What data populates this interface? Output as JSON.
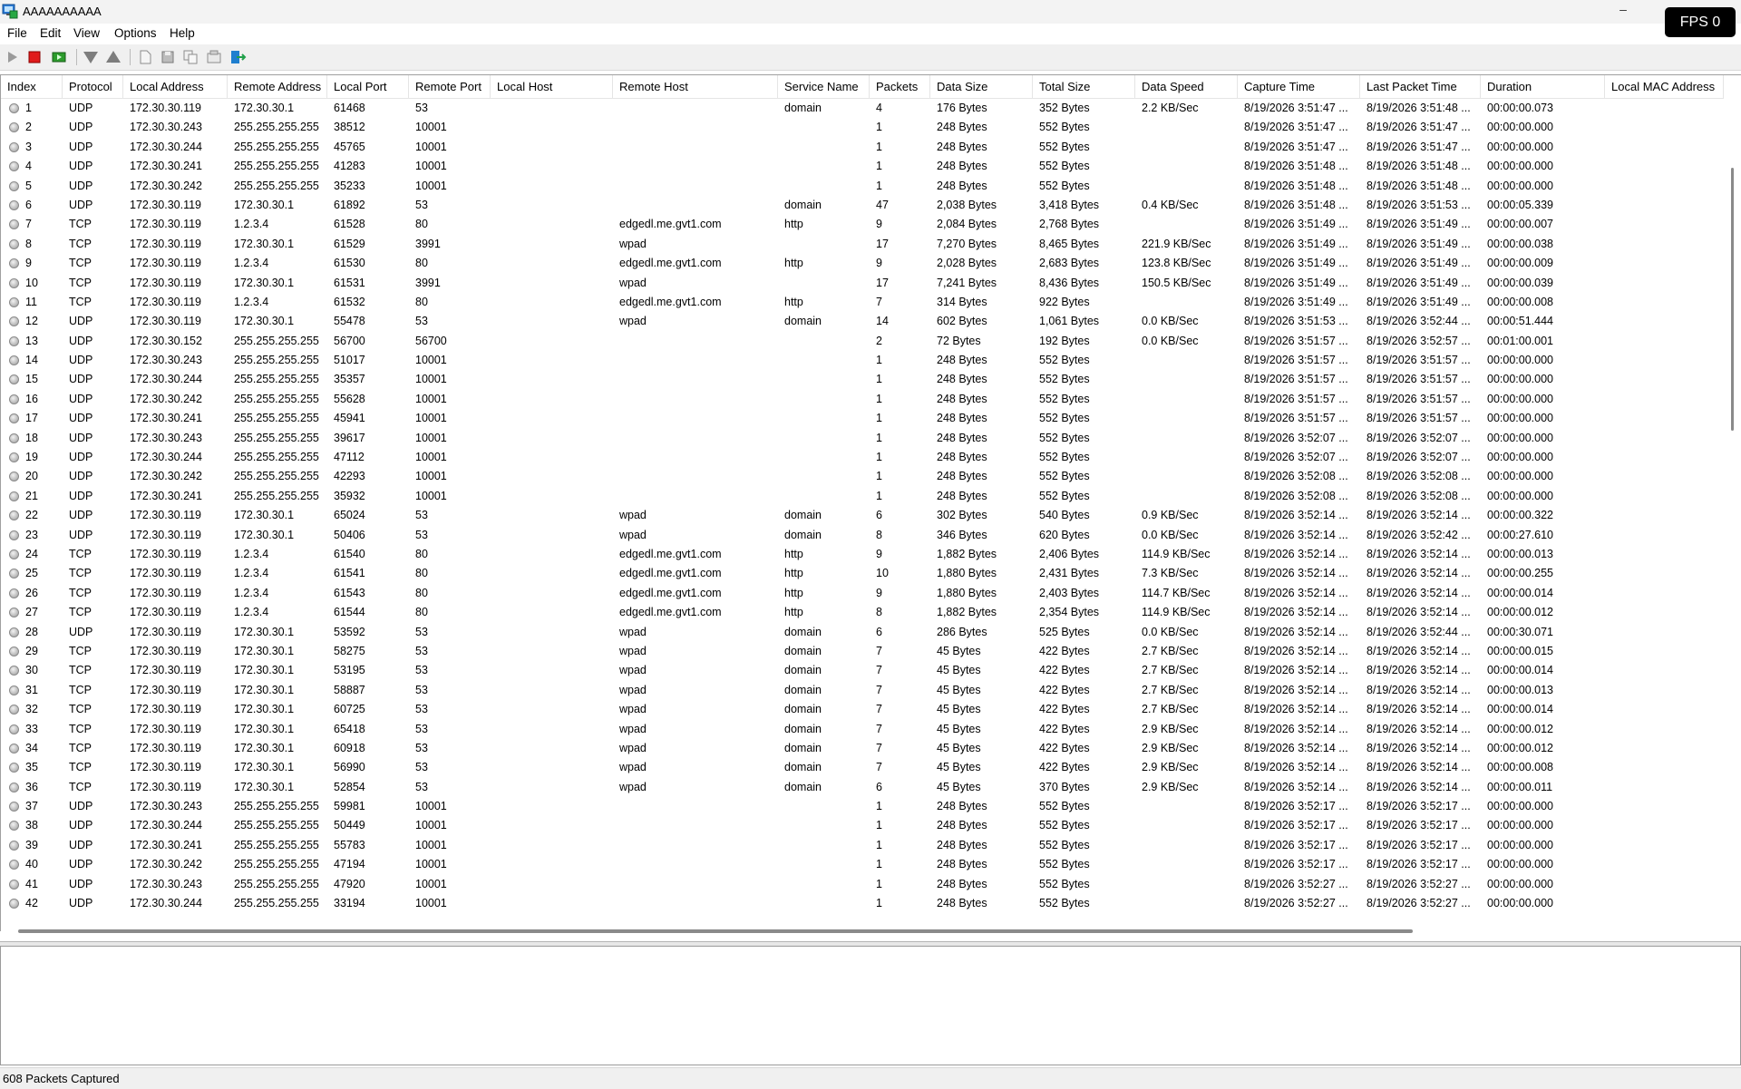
{
  "window": {
    "title": "AAAAAAAAAA",
    "minimize": "–"
  },
  "fps": "FPS 0",
  "menu": [
    "File",
    "Edit",
    "View",
    "Options",
    "Help"
  ],
  "toolbar": [
    "start-capture",
    "stop-capture",
    "clear-list",
    "filter-down",
    "filter-up",
    "new-file",
    "save",
    "copy",
    "properties",
    "exit"
  ],
  "columns": [
    "Index",
    "Protocol",
    "Local Address",
    "Remote Address",
    "Local Port",
    "Remote Port",
    "Local Host",
    "Remote Host",
    "Service Name",
    "Packets",
    "Data Size",
    "Total Size",
    "Data Speed",
    "Capture Time",
    "Last Packet Time",
    "Duration",
    "Local MAC Address"
  ],
  "rows": [
    [
      "1",
      "UDP",
      "172.30.30.119",
      "172.30.30.1",
      "61468",
      "53",
      "",
      "",
      "domain",
      "4",
      "176 Bytes",
      "352 Bytes",
      "2.2 KB/Sec",
      "8/19/2026 3:51:47 ...",
      "8/19/2026 3:51:48 ...",
      "00:00:00.073",
      ""
    ],
    [
      "2",
      "UDP",
      "172.30.30.243",
      "255.255.255.255",
      "38512",
      "10001",
      "",
      "",
      "",
      "1",
      "248 Bytes",
      "552 Bytes",
      "",
      "8/19/2026 3:51:47 ...",
      "8/19/2026 3:51:47 ...",
      "00:00:00.000",
      ""
    ],
    [
      "3",
      "UDP",
      "172.30.30.244",
      "255.255.255.255",
      "45765",
      "10001",
      "",
      "",
      "",
      "1",
      "248 Bytes",
      "552 Bytes",
      "",
      "8/19/2026 3:51:47 ...",
      "8/19/2026 3:51:47 ...",
      "00:00:00.000",
      ""
    ],
    [
      "4",
      "UDP",
      "172.30.30.241",
      "255.255.255.255",
      "41283",
      "10001",
      "",
      "",
      "",
      "1",
      "248 Bytes",
      "552 Bytes",
      "",
      "8/19/2026 3:51:48 ...",
      "8/19/2026 3:51:48 ...",
      "00:00:00.000",
      ""
    ],
    [
      "5",
      "UDP",
      "172.30.30.242",
      "255.255.255.255",
      "35233",
      "10001",
      "",
      "",
      "",
      "1",
      "248 Bytes",
      "552 Bytes",
      "",
      "8/19/2026 3:51:48 ...",
      "8/19/2026 3:51:48 ...",
      "00:00:00.000",
      ""
    ],
    [
      "6",
      "UDP",
      "172.30.30.119",
      "172.30.30.1",
      "61892",
      "53",
      "",
      "",
      "domain",
      "47",
      "2,038 Bytes",
      "3,418 Bytes",
      "0.4 KB/Sec",
      "8/19/2026 3:51:48 ...",
      "8/19/2026 3:51:53 ...",
      "00:00:05.339",
      ""
    ],
    [
      "7",
      "TCP",
      "172.30.30.119",
      "1.2.3.4",
      "61528",
      "80",
      "",
      "edgedl.me.gvt1.com",
      "http",
      "9",
      "2,084 Bytes",
      "2,768 Bytes",
      "",
      "8/19/2026 3:51:49 ...",
      "8/19/2026 3:51:49 ...",
      "00:00:00.007",
      ""
    ],
    [
      "8",
      "TCP",
      "172.30.30.119",
      "172.30.30.1",
      "61529",
      "3991",
      "",
      "wpad",
      "",
      "17",
      "7,270 Bytes",
      "8,465 Bytes",
      "221.9 KB/Sec",
      "8/19/2026 3:51:49 ...",
      "8/19/2026 3:51:49 ...",
      "00:00:00.038",
      ""
    ],
    [
      "9",
      "TCP",
      "172.30.30.119",
      "1.2.3.4",
      "61530",
      "80",
      "",
      "edgedl.me.gvt1.com",
      "http",
      "9",
      "2,028 Bytes",
      "2,683 Bytes",
      "123.8 KB/Sec",
      "8/19/2026 3:51:49 ...",
      "8/19/2026 3:51:49 ...",
      "00:00:00.009",
      ""
    ],
    [
      "10",
      "TCP",
      "172.30.30.119",
      "172.30.30.1",
      "61531",
      "3991",
      "",
      "wpad",
      "",
      "17",
      "7,241 Bytes",
      "8,436 Bytes",
      "150.5 KB/Sec",
      "8/19/2026 3:51:49 ...",
      "8/19/2026 3:51:49 ...",
      "00:00:00.039",
      ""
    ],
    [
      "11",
      "TCP",
      "172.30.30.119",
      "1.2.3.4",
      "61532",
      "80",
      "",
      "edgedl.me.gvt1.com",
      "http",
      "7",
      "314 Bytes",
      "922 Bytes",
      "",
      "8/19/2026 3:51:49 ...",
      "8/19/2026 3:51:49 ...",
      "00:00:00.008",
      ""
    ],
    [
      "12",
      "UDP",
      "172.30.30.119",
      "172.30.30.1",
      "55478",
      "53",
      "",
      "wpad",
      "domain",
      "14",
      "602 Bytes",
      "1,061 Bytes",
      "0.0 KB/Sec",
      "8/19/2026 3:51:53 ...",
      "8/19/2026 3:52:44 ...",
      "00:00:51.444",
      ""
    ],
    [
      "13",
      "UDP",
      "172.30.30.152",
      "255.255.255.255",
      "56700",
      "56700",
      "",
      "",
      "",
      "2",
      "72 Bytes",
      "192 Bytes",
      "0.0 KB/Sec",
      "8/19/2026 3:51:57 ...",
      "8/19/2026 3:52:57 ...",
      "00:01:00.001",
      ""
    ],
    [
      "14",
      "UDP",
      "172.30.30.243",
      "255.255.255.255",
      "51017",
      "10001",
      "",
      "",
      "",
      "1",
      "248 Bytes",
      "552 Bytes",
      "",
      "8/19/2026 3:51:57 ...",
      "8/19/2026 3:51:57 ...",
      "00:00:00.000",
      ""
    ],
    [
      "15",
      "UDP",
      "172.30.30.244",
      "255.255.255.255",
      "35357",
      "10001",
      "",
      "",
      "",
      "1",
      "248 Bytes",
      "552 Bytes",
      "",
      "8/19/2026 3:51:57 ...",
      "8/19/2026 3:51:57 ...",
      "00:00:00.000",
      ""
    ],
    [
      "16",
      "UDP",
      "172.30.30.242",
      "255.255.255.255",
      "55628",
      "10001",
      "",
      "",
      "",
      "1",
      "248 Bytes",
      "552 Bytes",
      "",
      "8/19/2026 3:51:57 ...",
      "8/19/2026 3:51:57 ...",
      "00:00:00.000",
      ""
    ],
    [
      "17",
      "UDP",
      "172.30.30.241",
      "255.255.255.255",
      "45941",
      "10001",
      "",
      "",
      "",
      "1",
      "248 Bytes",
      "552 Bytes",
      "",
      "8/19/2026 3:51:57 ...",
      "8/19/2026 3:51:57 ...",
      "00:00:00.000",
      ""
    ],
    [
      "18",
      "UDP",
      "172.30.30.243",
      "255.255.255.255",
      "39617",
      "10001",
      "",
      "",
      "",
      "1",
      "248 Bytes",
      "552 Bytes",
      "",
      "8/19/2026 3:52:07 ...",
      "8/19/2026 3:52:07 ...",
      "00:00:00.000",
      ""
    ],
    [
      "19",
      "UDP",
      "172.30.30.244",
      "255.255.255.255",
      "47112",
      "10001",
      "",
      "",
      "",
      "1",
      "248 Bytes",
      "552 Bytes",
      "",
      "8/19/2026 3:52:07 ...",
      "8/19/2026 3:52:07 ...",
      "00:00:00.000",
      ""
    ],
    [
      "20",
      "UDP",
      "172.30.30.242",
      "255.255.255.255",
      "42293",
      "10001",
      "",
      "",
      "",
      "1",
      "248 Bytes",
      "552 Bytes",
      "",
      "8/19/2026 3:52:08 ...",
      "8/19/2026 3:52:08 ...",
      "00:00:00.000",
      ""
    ],
    [
      "21",
      "UDP",
      "172.30.30.241",
      "255.255.255.255",
      "35932",
      "10001",
      "",
      "",
      "",
      "1",
      "248 Bytes",
      "552 Bytes",
      "",
      "8/19/2026 3:52:08 ...",
      "8/19/2026 3:52:08 ...",
      "00:00:00.000",
      ""
    ],
    [
      "22",
      "UDP",
      "172.30.30.119",
      "172.30.30.1",
      "65024",
      "53",
      "",
      "wpad",
      "domain",
      "6",
      "302 Bytes",
      "540 Bytes",
      "0.9 KB/Sec",
      "8/19/2026 3:52:14 ...",
      "8/19/2026 3:52:14 ...",
      "00:00:00.322",
      ""
    ],
    [
      "23",
      "UDP",
      "172.30.30.119",
      "172.30.30.1",
      "50406",
      "53",
      "",
      "wpad",
      "domain",
      "8",
      "346 Bytes",
      "620 Bytes",
      "0.0 KB/Sec",
      "8/19/2026 3:52:14 ...",
      "8/19/2026 3:52:42 ...",
      "00:00:27.610",
      ""
    ],
    [
      "24",
      "TCP",
      "172.30.30.119",
      "1.2.3.4",
      "61540",
      "80",
      "",
      "edgedl.me.gvt1.com",
      "http",
      "9",
      "1,882 Bytes",
      "2,406 Bytes",
      "114.9 KB/Sec",
      "8/19/2026 3:52:14 ...",
      "8/19/2026 3:52:14 ...",
      "00:00:00.013",
      ""
    ],
    [
      "25",
      "TCP",
      "172.30.30.119",
      "1.2.3.4",
      "61541",
      "80",
      "",
      "edgedl.me.gvt1.com",
      "http",
      "10",
      "1,880 Bytes",
      "2,431 Bytes",
      "7.3 KB/Sec",
      "8/19/2026 3:52:14 ...",
      "8/19/2026 3:52:14 ...",
      "00:00:00.255",
      ""
    ],
    [
      "26",
      "TCP",
      "172.30.30.119",
      "1.2.3.4",
      "61543",
      "80",
      "",
      "edgedl.me.gvt1.com",
      "http",
      "9",
      "1,880 Bytes",
      "2,403 Bytes",
      "114.7 KB/Sec",
      "8/19/2026 3:52:14 ...",
      "8/19/2026 3:52:14 ...",
      "00:00:00.014",
      ""
    ],
    [
      "27",
      "TCP",
      "172.30.30.119",
      "1.2.3.4",
      "61544",
      "80",
      "",
      "edgedl.me.gvt1.com",
      "http",
      "8",
      "1,882 Bytes",
      "2,354 Bytes",
      "114.9 KB/Sec",
      "8/19/2026 3:52:14 ...",
      "8/19/2026 3:52:14 ...",
      "00:00:00.012",
      ""
    ],
    [
      "28",
      "UDP",
      "172.30.30.119",
      "172.30.30.1",
      "53592",
      "53",
      "",
      "wpad",
      "domain",
      "6",
      "286 Bytes",
      "525 Bytes",
      "0.0 KB/Sec",
      "8/19/2026 3:52:14 ...",
      "8/19/2026 3:52:44 ...",
      "00:00:30.071",
      ""
    ],
    [
      "29",
      "TCP",
      "172.30.30.119",
      "172.30.30.1",
      "58275",
      "53",
      "",
      "wpad",
      "domain",
      "7",
      "45 Bytes",
      "422 Bytes",
      "2.7 KB/Sec",
      "8/19/2026 3:52:14 ...",
      "8/19/2026 3:52:14 ...",
      "00:00:00.015",
      ""
    ],
    [
      "30",
      "TCP",
      "172.30.30.119",
      "172.30.30.1",
      "53195",
      "53",
      "",
      "wpad",
      "domain",
      "7",
      "45 Bytes",
      "422 Bytes",
      "2.7 KB/Sec",
      "8/19/2026 3:52:14 ...",
      "8/19/2026 3:52:14 ...",
      "00:00:00.014",
      ""
    ],
    [
      "31",
      "TCP",
      "172.30.30.119",
      "172.30.30.1",
      "58887",
      "53",
      "",
      "wpad",
      "domain",
      "7",
      "45 Bytes",
      "422 Bytes",
      "2.7 KB/Sec",
      "8/19/2026 3:52:14 ...",
      "8/19/2026 3:52:14 ...",
      "00:00:00.013",
      ""
    ],
    [
      "32",
      "TCP",
      "172.30.30.119",
      "172.30.30.1",
      "60725",
      "53",
      "",
      "wpad",
      "domain",
      "7",
      "45 Bytes",
      "422 Bytes",
      "2.7 KB/Sec",
      "8/19/2026 3:52:14 ...",
      "8/19/2026 3:52:14 ...",
      "00:00:00.014",
      ""
    ],
    [
      "33",
      "TCP",
      "172.30.30.119",
      "172.30.30.1",
      "65418",
      "53",
      "",
      "wpad",
      "domain",
      "7",
      "45 Bytes",
      "422 Bytes",
      "2.9 KB/Sec",
      "8/19/2026 3:52:14 ...",
      "8/19/2026 3:52:14 ...",
      "00:00:00.012",
      ""
    ],
    [
      "34",
      "TCP",
      "172.30.30.119",
      "172.30.30.1",
      "60918",
      "53",
      "",
      "wpad",
      "domain",
      "7",
      "45 Bytes",
      "422 Bytes",
      "2.9 KB/Sec",
      "8/19/2026 3:52:14 ...",
      "8/19/2026 3:52:14 ...",
      "00:00:00.012",
      ""
    ],
    [
      "35",
      "TCP",
      "172.30.30.119",
      "172.30.30.1",
      "56990",
      "53",
      "",
      "wpad",
      "domain",
      "7",
      "45 Bytes",
      "422 Bytes",
      "2.9 KB/Sec",
      "8/19/2026 3:52:14 ...",
      "8/19/2026 3:52:14 ...",
      "00:00:00.008",
      ""
    ],
    [
      "36",
      "TCP",
      "172.30.30.119",
      "172.30.30.1",
      "52854",
      "53",
      "",
      "wpad",
      "domain",
      "6",
      "45 Bytes",
      "370 Bytes",
      "2.9 KB/Sec",
      "8/19/2026 3:52:14 ...",
      "8/19/2026 3:52:14 ...",
      "00:00:00.011",
      ""
    ],
    [
      "37",
      "UDP",
      "172.30.30.243",
      "255.255.255.255",
      "59981",
      "10001",
      "",
      "",
      "",
      "1",
      "248 Bytes",
      "552 Bytes",
      "",
      "8/19/2026 3:52:17 ...",
      "8/19/2026 3:52:17 ...",
      "00:00:00.000",
      ""
    ],
    [
      "38",
      "UDP",
      "172.30.30.244",
      "255.255.255.255",
      "50449",
      "10001",
      "",
      "",
      "",
      "1",
      "248 Bytes",
      "552 Bytes",
      "",
      "8/19/2026 3:52:17 ...",
      "8/19/2026 3:52:17 ...",
      "00:00:00.000",
      ""
    ],
    [
      "39",
      "UDP",
      "172.30.30.241",
      "255.255.255.255",
      "55783",
      "10001",
      "",
      "",
      "",
      "1",
      "248 Bytes",
      "552 Bytes",
      "",
      "8/19/2026 3:52:17 ...",
      "8/19/2026 3:52:17 ...",
      "00:00:00.000",
      ""
    ],
    [
      "40",
      "UDP",
      "172.30.30.242",
      "255.255.255.255",
      "47194",
      "10001",
      "",
      "",
      "",
      "1",
      "248 Bytes",
      "552 Bytes",
      "",
      "8/19/2026 3:52:17 ...",
      "8/19/2026 3:52:17 ...",
      "00:00:00.000",
      ""
    ],
    [
      "41",
      "UDP",
      "172.30.30.243",
      "255.255.255.255",
      "47920",
      "10001",
      "",
      "",
      "",
      "1",
      "248 Bytes",
      "552 Bytes",
      "",
      "8/19/2026 3:52:27 ...",
      "8/19/2026 3:52:27 ...",
      "00:00:00.000",
      ""
    ],
    [
      "42",
      "UDP",
      "172.30.30.244",
      "255.255.255.255",
      "33194",
      "10001",
      "",
      "",
      "",
      "1",
      "248 Bytes",
      "552 Bytes",
      "",
      "8/19/2026 3:52:27 ...",
      "8/19/2026 3:52:27 ...",
      "00:00:00.000",
      ""
    ]
  ],
  "status": "608 Packets Captured"
}
